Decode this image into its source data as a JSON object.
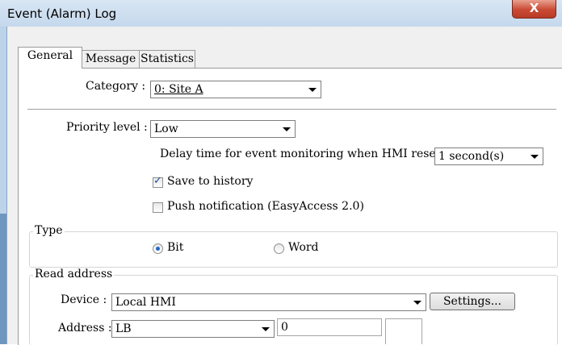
{
  "window": {
    "title": "Event (Alarm) Log",
    "close_glyph": "X"
  },
  "tabs": [
    {
      "label": "General",
      "active": true
    },
    {
      "label": "Message",
      "active": false
    },
    {
      "label": "Statistics",
      "active": false
    }
  ],
  "general": {
    "category": {
      "label": "Category :",
      "value": "0: Site A"
    },
    "priority": {
      "label": "Priority level :",
      "value": "Low"
    },
    "delay": {
      "label": "Delay time for event monitoring when HMI resets :",
      "value": "1 second(s)"
    },
    "save_to_history": {
      "label": "Save to history",
      "checked": true
    },
    "push_notification": {
      "label": "Push notification (EasyAccess 2.0)",
      "checked": false
    },
    "type": {
      "title": "Type",
      "options": [
        {
          "label": "Bit",
          "selected": true
        },
        {
          "label": "Word",
          "selected": false
        }
      ]
    },
    "read_address": {
      "title": "Read address",
      "device_label": "Device :",
      "device_value": "Local HMI",
      "settings_button": "Settings...",
      "address_label": "Address :",
      "address_type": "LB",
      "address_value": "0"
    }
  },
  "colors": {
    "title_bar": "#c5d8ec",
    "close_button": "#c94a34",
    "radio_dot": "#2466c9",
    "check_mark": "#1d4d9a"
  },
  "icons": {
    "close": "close-icon",
    "dropdown": "chevron-down-icon"
  }
}
